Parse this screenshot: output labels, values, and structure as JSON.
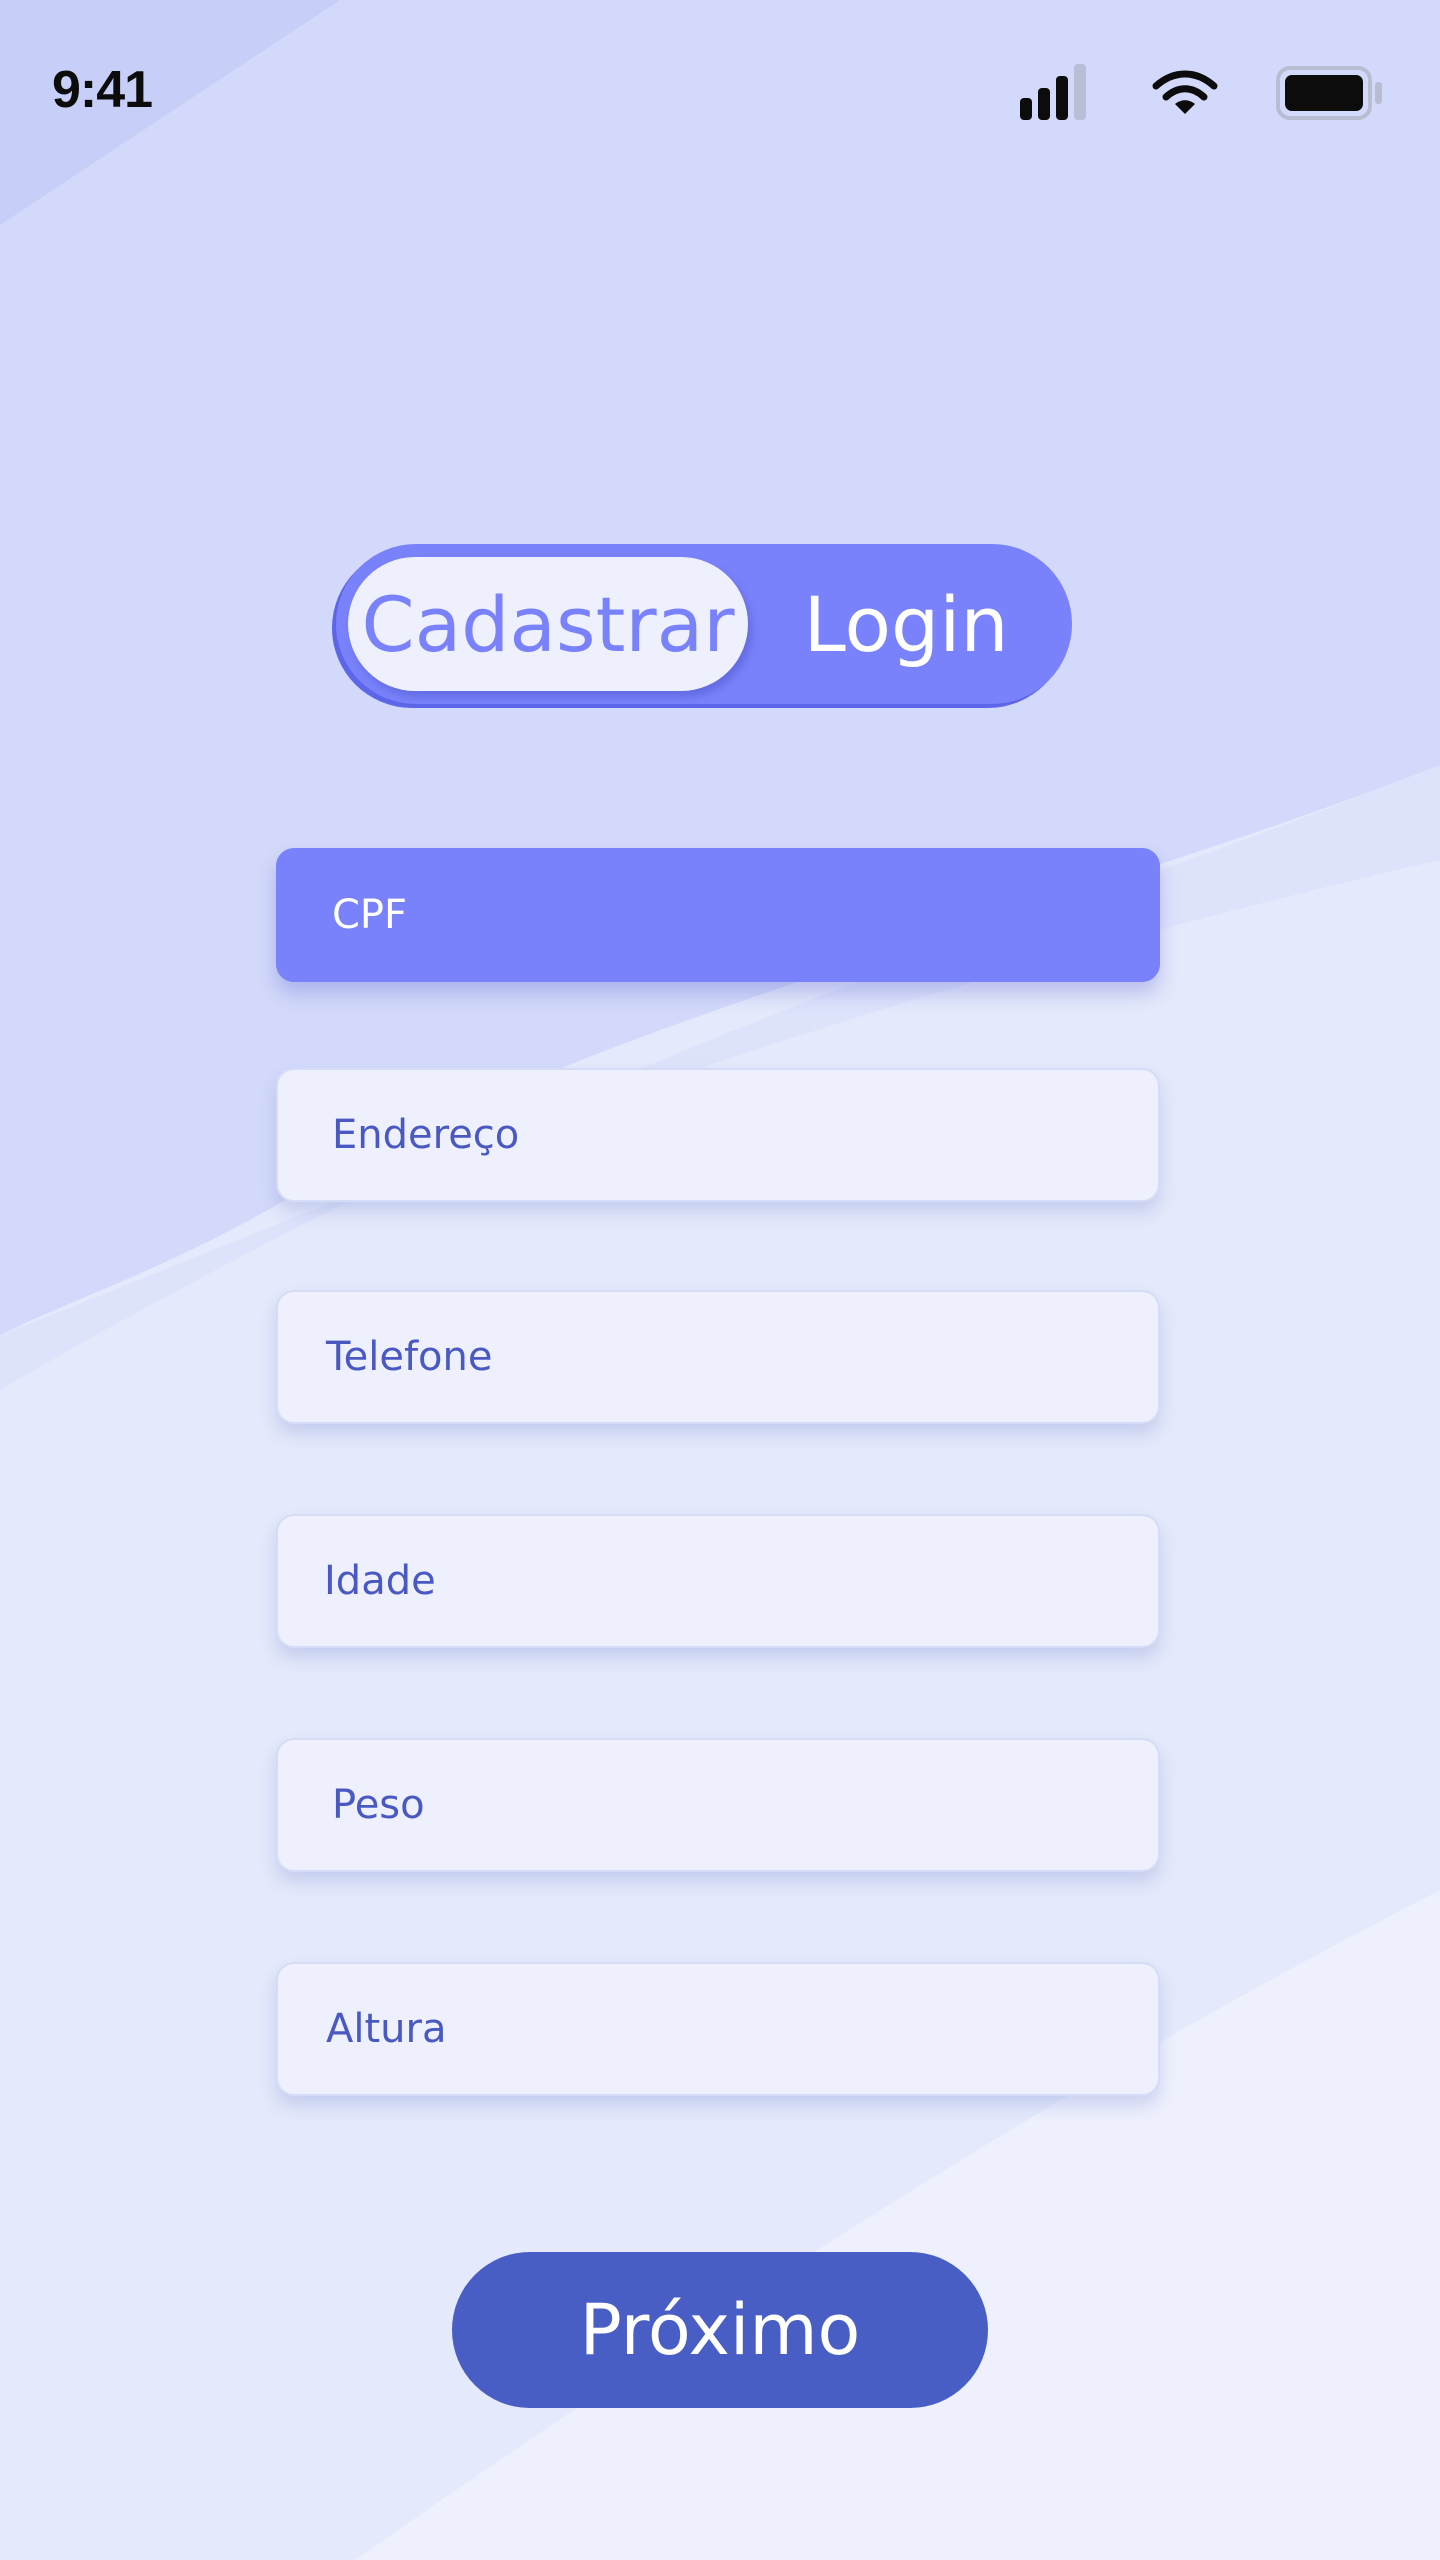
{
  "status_bar": {
    "time": "9:41",
    "icons": [
      "cellular-signal-icon",
      "wifi-icon",
      "battery-icon"
    ]
  },
  "auth_toggle": {
    "options": [
      {
        "label": "Cadastrar",
        "selected": true
      },
      {
        "label": "Login",
        "selected": false
      }
    ]
  },
  "form": {
    "fields": [
      {
        "label": "CPF",
        "active": true
      },
      {
        "label": "Endereço",
        "active": false
      },
      {
        "label": "Telefone",
        "active": false
      },
      {
        "label": "Idade",
        "active": false
      },
      {
        "label": "Peso",
        "active": false
      },
      {
        "label": "Altura",
        "active": false
      }
    ]
  },
  "next_button": {
    "label": "Próximo"
  },
  "colors": {
    "accent": "#7982fb",
    "button": "#485ec5",
    "field_background": "#eef0fd",
    "label_text": "#4a59c2",
    "background": "#e4e9fb"
  }
}
